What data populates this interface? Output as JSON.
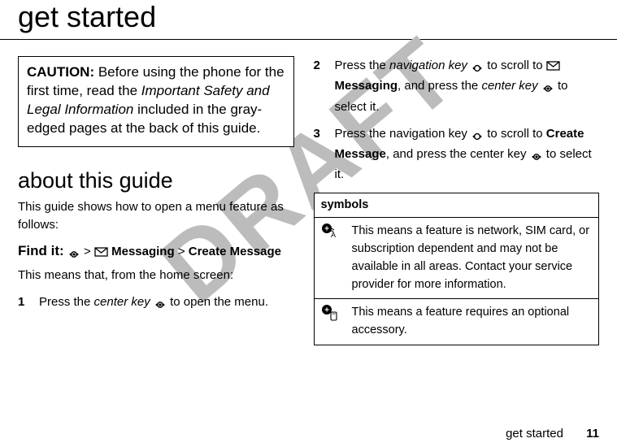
{
  "watermark": "DRAFT",
  "title": "get started",
  "caution": {
    "lead": "CAUTION:",
    "part1": " Before using the phone for the first time, read the ",
    "italic": "Important Safety and Legal Information",
    "part2": " included in the gray-edged pages at the back of this guide."
  },
  "about_heading": "about this guide",
  "about_body": "This guide shows how to open a menu feature as follows:",
  "findit": {
    "lead": "Find it:",
    "sep": " > ",
    "messaging": "Messaging",
    "create": "Create Message"
  },
  "means": "This means that, from the home screen:",
  "steps": {
    "s1": {
      "num": "1",
      "a": "Press the ",
      "b": "center key",
      "c": " to open the menu."
    },
    "s2": {
      "num": "2",
      "a": "Press the ",
      "b": "navigation key",
      "c": " to scroll to ",
      "d": "Messaging",
      "e": ", and press the ",
      "f": "center key",
      "g": " to select it."
    },
    "s3": {
      "num": "3",
      "a": "Press the navigation key ",
      "b": " to scroll to ",
      "c": "Create Message",
      "d": ", and press the center key ",
      "e": " to select it."
    }
  },
  "symbols": {
    "header": "symbols",
    "r1": "This means a feature is network, SIM card, or subscription dependent and may not be available in all areas. Contact your service provider for more information.",
    "r2": "This means a feature requires an optional accessory."
  },
  "footer": {
    "section": "get started",
    "page": "11"
  },
  "icons": {
    "center_key": "center-key",
    "nav_key": "nav-key",
    "envelope": "envelope",
    "network_plus": "network-plus",
    "accessory_plus": "accessory-plus"
  }
}
